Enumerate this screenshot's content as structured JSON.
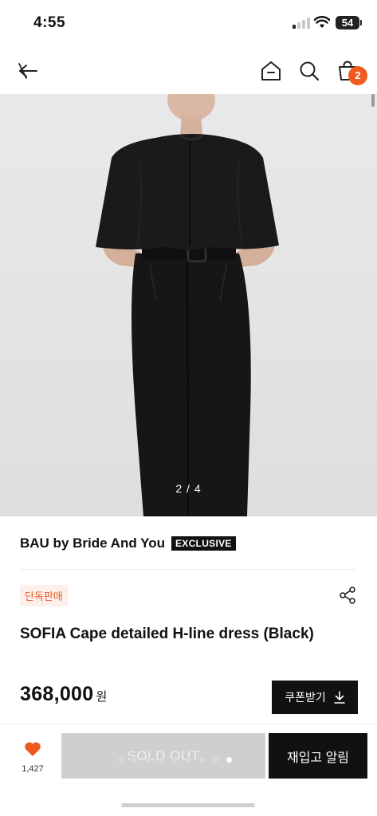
{
  "status_bar": {
    "time": "4:55",
    "battery": "54"
  },
  "nav": {
    "cart_count": "2",
    "icons": [
      "close-arrow-icon",
      "home-icon",
      "search-icon",
      "shopping-bag-icon"
    ]
  },
  "gallery": {
    "counter": "2 / 4"
  },
  "product": {
    "brand": "BAU by Bride And You",
    "exclusive_badge": "EXCLUSIVE",
    "tag": "단독판매",
    "title": "SOFIA Cape detailed H-line dress (Black)",
    "price": "368,000",
    "currency": "원"
  },
  "actions": {
    "coupon_label": "쿠폰받기",
    "like_count": "1,427",
    "sold_out_label": "SOLD OUT",
    "restock_label": "재입고 알림"
  },
  "colors": {
    "accent": "#f05a1e",
    "primary": "#111111",
    "tag_bg": "#fdf0ea",
    "tag_text": "#e5602a"
  }
}
